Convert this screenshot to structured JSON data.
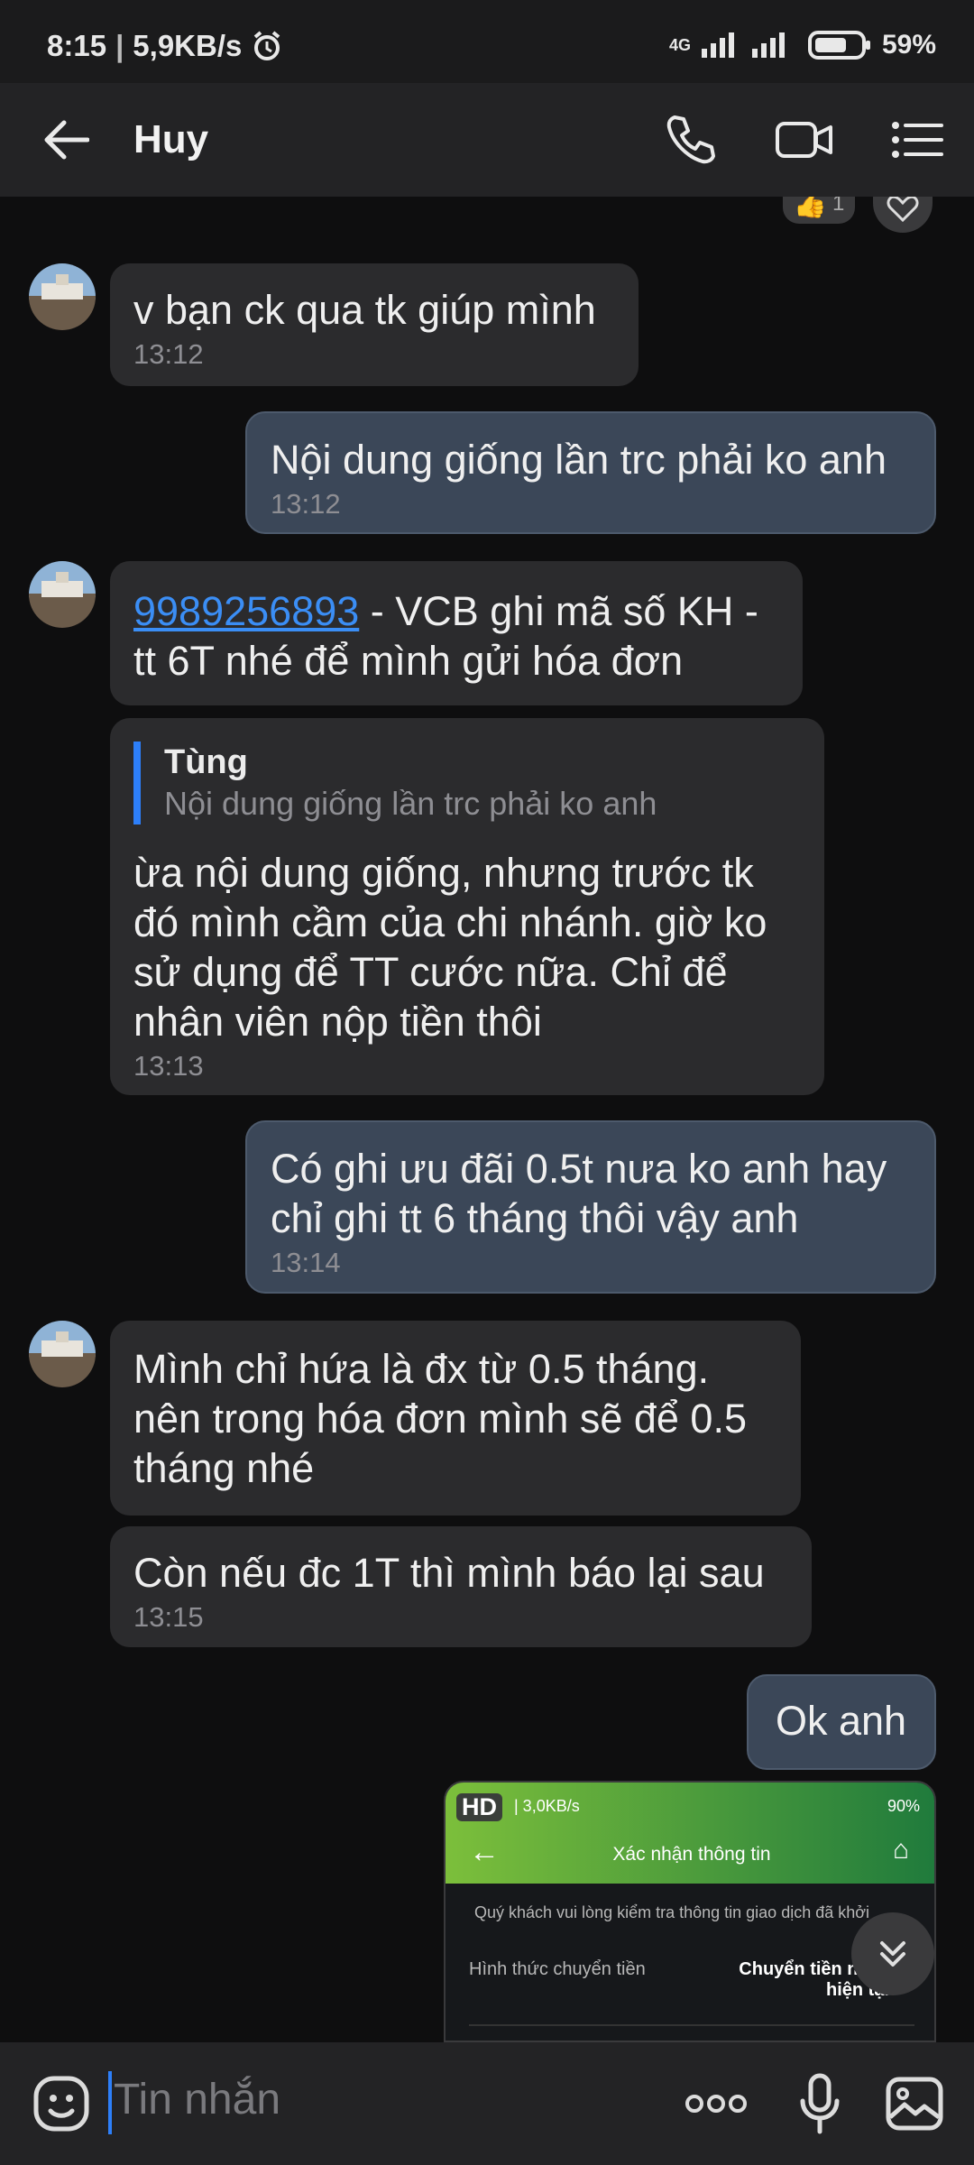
{
  "status_bar": {
    "time": "8:15",
    "net_speed": "5,9KB/s",
    "network": "4G",
    "battery": "59%",
    "icons": [
      "alarm-icon",
      "signal-icon",
      "battery-icon"
    ]
  },
  "header": {
    "title": "Huy",
    "icons": [
      "back-arrow-icon",
      "phone-call-icon",
      "video-call-icon",
      "menu-list-icon"
    ]
  },
  "reactions": {
    "like_count": "1"
  },
  "messages": [
    {
      "side": "received",
      "text": "v bạn ck qua tk giúp mình",
      "time": "13:12"
    },
    {
      "side": "sent",
      "text": "Nội dung giống lần trc phải ko anh",
      "time": "13:12"
    },
    {
      "side": "received",
      "link": "9989256893",
      "text": " - VCB ghi mã số KH - tt 6T nhé để mình gửi hóa đơn",
      "time": ""
    },
    {
      "side": "received",
      "quote_name": "Tùng",
      "quote_text": "Nội dung giống lần trc phải ko anh",
      "text": "ừa nội dung giống, nhưng trước tk đó mình cầm của chi nhánh. giờ ko sử dụng để TT cước nữa. Chỉ để nhân viên nộp tiền thôi",
      "time": "13:13"
    },
    {
      "side": "sent",
      "text": "Có ghi ưu đãi 0.5t nưa ko anh hay chỉ ghi tt 6 tháng thôi vậy anh",
      "time": "13:14"
    },
    {
      "side": "received",
      "text": "Mình chỉ hứa là đx từ 0.5 tháng. nên trong hóa đơn mình sẽ để 0.5 tháng nhé",
      "time": ""
    },
    {
      "side": "received",
      "text": "Còn nếu đc 1T thì mình báo lại sau",
      "time": "13:15"
    },
    {
      "side": "sent",
      "text": "Ok anh",
      "time": ""
    }
  ],
  "image_preview": {
    "hd_badge": "HD",
    "status_left": "| 3,0KB/s",
    "status_battery": "90%",
    "title": "Xác nhận thông tin",
    "notice": "Quý khách vui lòng kiểm tra thông tin giao dịch đã khởi",
    "label": "Hình thức chuyển tiền",
    "value_line1": "Chuyển tiền ngày",
    "value_line2": "hiện tại"
  },
  "composer": {
    "placeholder": "Tin nhắn",
    "icons": [
      "sticker-icon",
      "more-dots-icon",
      "microphone-icon",
      "gallery-icon"
    ]
  },
  "colors": {
    "background": "#0e0e0f",
    "received_bubble": "#2b2b2d",
    "sent_bubble": "#3b4758",
    "accent": "#2d7ff9",
    "link": "#3b8ef5"
  }
}
